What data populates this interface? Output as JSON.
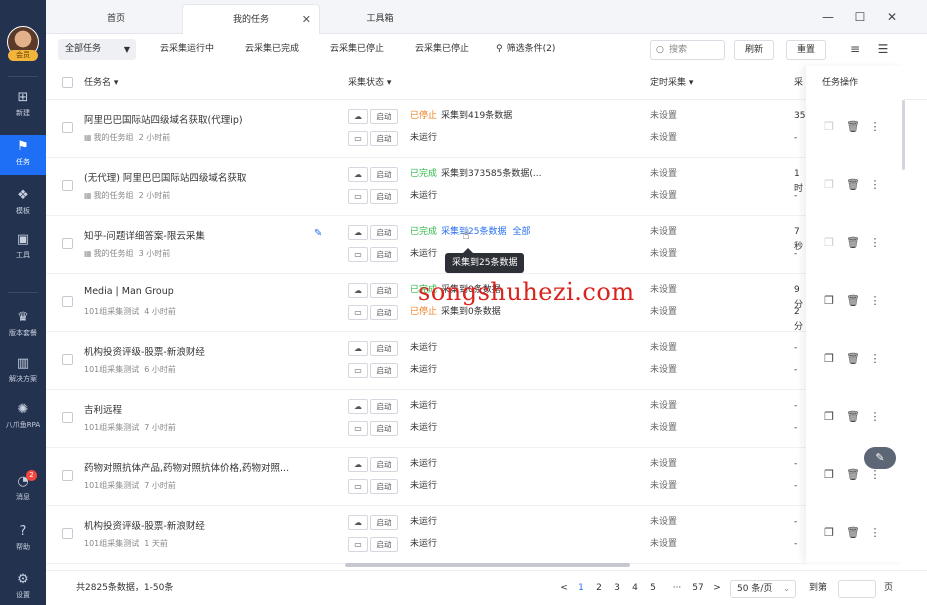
{
  "sidebar": {
    "avatar_badge": "会员",
    "items": [
      {
        "label": "新建",
        "icon": "plus-square-icon"
      },
      {
        "label": "任务",
        "icon": "task-flag-icon"
      },
      {
        "label": "模板",
        "icon": "template-icon"
      },
      {
        "label": "工具",
        "icon": "toolbox-icon"
      },
      {
        "label": "版本套餐",
        "icon": "crown-icon"
      },
      {
        "label": "解决方案",
        "icon": "solution-icon"
      },
      {
        "label": "八爪鱼RPA",
        "icon": "octopus-icon"
      },
      {
        "label": "消息",
        "icon": "bell-icon",
        "badge": "2"
      },
      {
        "label": "帮助",
        "icon": "help-icon"
      },
      {
        "label": "设置",
        "icon": "gear-icon"
      }
    ]
  },
  "tabs": [
    {
      "label": "首页"
    },
    {
      "label": "我的任务",
      "active": true
    },
    {
      "label": "工具箱"
    }
  ],
  "window": {
    "minimize": "—",
    "maximize": "☐",
    "close": "✕"
  },
  "toolbar": {
    "filter_select": "全部任务",
    "links": [
      "云采集运行中",
      "云采集已完成",
      "云采集已停止",
      "云采集已停止"
    ],
    "filter_conditions": "筛选条件(2)",
    "search_placeholder": "搜索",
    "refresh": "刷新",
    "reset": "重置"
  },
  "table": {
    "headers": {
      "name": "任务名 ▾",
      "status": "采集状态 ▾",
      "schedule": "定时采集 ▾",
      "cloud": "采",
      "actions": "任务操作"
    },
    "start_label": "启动",
    "rows": [
      {
        "name": "阿里巴巴国际站四级域名获取(代理ip)",
        "group": "我的任务组",
        "time": "2 小时前",
        "group_icon": true,
        "cloud_status": "已停止",
        "cloud_status_type": "stop",
        "cloud_text": "采集到419条数据",
        "local_status": "未运行",
        "sched1": "未设置",
        "sched2": "未设置",
        "cloud_col1": "35",
        "cloud_col2": "-",
        "copy_dim": true
      },
      {
        "name": "(无代理) 阿里巴巴国际站四级域名获取",
        "group": "我的任务组",
        "time": "2 小时前",
        "group_icon": true,
        "cloud_status": "已完成",
        "cloud_status_type": "done",
        "cloud_text": "采集到373585条数据(...",
        "local_status": "未运行",
        "sched1": "未设置",
        "sched2": "未设置",
        "cloud_col1": "1时",
        "cloud_col2": "-",
        "copy_dim": true
      },
      {
        "name": "知乎-问题详细答案-限云采集",
        "group": "我的任务组",
        "time": "3 小时前",
        "group_icon": true,
        "edit": true,
        "cloud_status": "已完成",
        "cloud_status_type": "done",
        "cloud_text": "采集到25条数据",
        "cloud_link": "全部",
        "local_status": "未运行",
        "sched1": "未设置",
        "sched2": "未设置",
        "cloud_col1": "7秒",
        "cloud_col2": "-",
        "copy_dim": true
      },
      {
        "name": "Media | Man Group",
        "group": "101组采集测试",
        "time": "4 小时前",
        "cloud_status": "已完成",
        "cloud_status_type": "done",
        "cloud_text": "采集到0条数据",
        "local_status": "已停止",
        "local_status_type": "stop",
        "local_text": "采集到0条数据",
        "sched1": "未设置",
        "sched2": "未设置",
        "cloud_col1": "9分",
        "cloud_col2": "2分"
      },
      {
        "name": "机构投资评级-股票-新浪财经",
        "group": "101组采集测试",
        "time": "6 小时前",
        "cloud_status": "未运行",
        "cloud_status_type": "none",
        "local_status": "未运行",
        "sched1": "未设置",
        "sched2": "未设置",
        "cloud_col1": "-",
        "cloud_col2": "-"
      },
      {
        "name": "吉利远程",
        "group": "101组采集测试",
        "time": "7 小时前",
        "cloud_status": "未运行",
        "cloud_status_type": "none",
        "local_status": "未运行",
        "sched1": "未设置",
        "sched2": "未设置",
        "cloud_col1": "-",
        "cloud_col2": "-"
      },
      {
        "name": "药物对照抗体产品,药物对照抗体价格,药物对照...",
        "group": "101组采集测试",
        "time": "7 小时前",
        "cloud_status": "未运行",
        "cloud_status_type": "none",
        "local_status": "未运行",
        "sched1": "未设置",
        "sched2": "未设置",
        "cloud_col1": "-",
        "cloud_col2": "-"
      },
      {
        "name": "机构投资评级-股票-新浪财经",
        "group": "101组采集测试",
        "time": "1 天前",
        "cloud_status": "未运行",
        "cloud_status_type": "none",
        "local_status": "未运行",
        "sched1": "未设置",
        "sched2": "未设置",
        "cloud_col1": "-",
        "cloud_col2": "-"
      }
    ]
  },
  "tooltip": "采集到25条数据",
  "watermark": "songshuhezi.com",
  "footer": {
    "total": "共2825条数据，1-50条",
    "prev": "<",
    "pages": [
      "1",
      "2",
      "3",
      "4",
      "5",
      "···",
      "57"
    ],
    "active_page": "1",
    "next": ">",
    "page_size": "50 条/页",
    "jump_label": "到第",
    "page_unit": "页"
  },
  "colors": {
    "sidebar": "#23324e",
    "accent": "#1e6ff5",
    "stopped": "#f0801e",
    "done": "#2fb84a",
    "link": "#2b6ff0"
  }
}
